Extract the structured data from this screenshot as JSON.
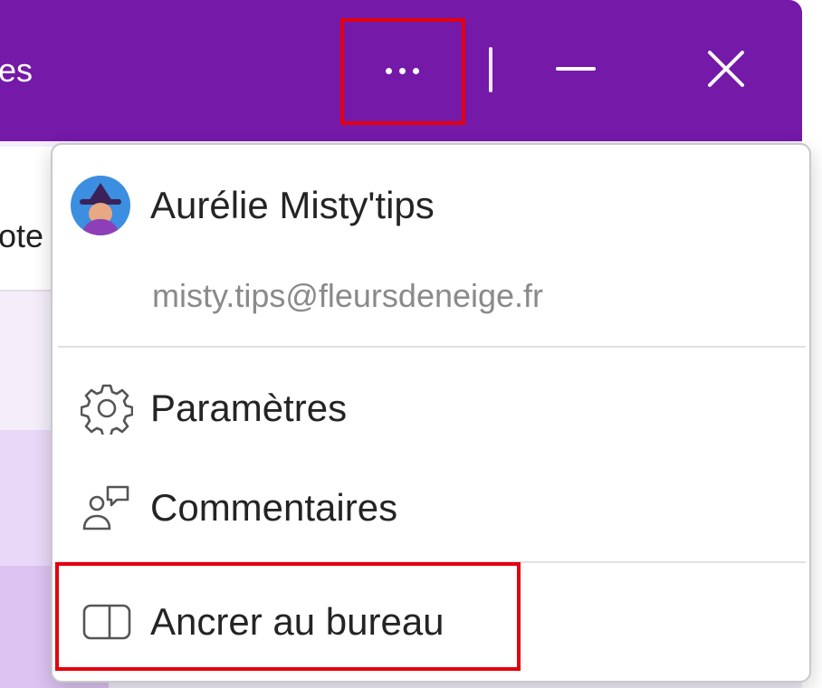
{
  "titlebar": {
    "title_partial": "es",
    "buttons": {
      "more_icon": "more-horizontal-icon",
      "minimize_icon": "minimize-icon",
      "close_icon": "close-icon"
    },
    "color": "#7419a8"
  },
  "background": {
    "card_text_partial": "ote"
  },
  "menu": {
    "user": {
      "name": "Aurélie Misty'tips",
      "email": "misty.tips@fleursdeneige.fr",
      "avatar_icon": "avatar-witch-icon"
    },
    "items": [
      {
        "label": "Paramètres",
        "icon": "gear-icon"
      },
      {
        "label": "Commentaires",
        "icon": "feedback-icon"
      },
      {
        "label": "Ancrer au bureau",
        "icon": "dock-panel-icon"
      }
    ]
  },
  "highlight_color": "#e3000f"
}
